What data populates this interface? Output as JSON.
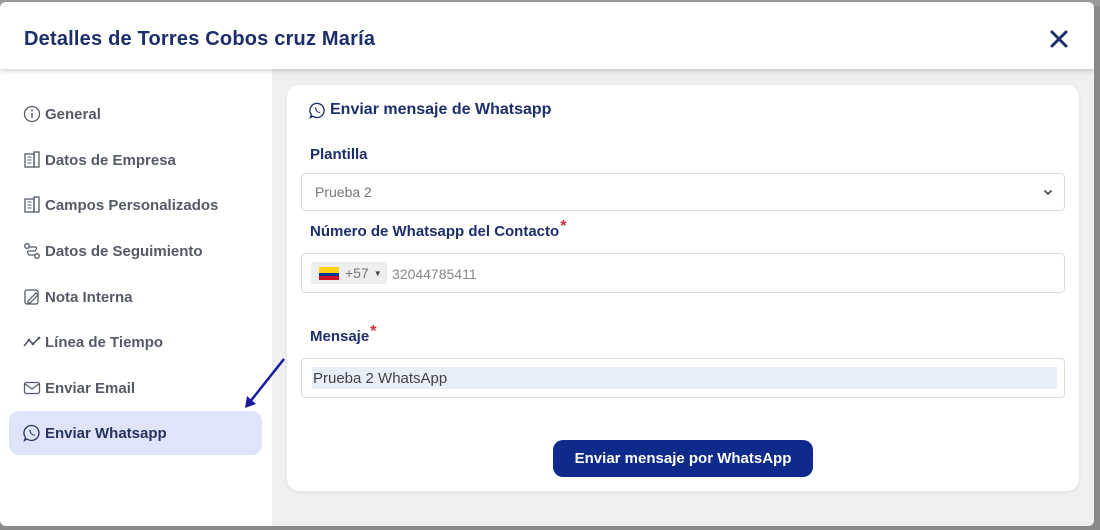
{
  "modal": {
    "title": "Detalles de Torres Cobos cruz María"
  },
  "sidebar": {
    "items": [
      {
        "label": "General",
        "icon": "info-icon"
      },
      {
        "label": "Datos de Empresa",
        "icon": "building-icon"
      },
      {
        "label": "Campos Personalizados",
        "icon": "building-icon"
      },
      {
        "label": "Datos de Seguimiento",
        "icon": "route-icon"
      },
      {
        "label": "Nota Interna",
        "icon": "edit-note-icon"
      },
      {
        "label": "Línea de Tiempo",
        "icon": "timeline-icon"
      },
      {
        "label": "Enviar Email",
        "icon": "envelope-icon"
      },
      {
        "label": "Enviar Whatsapp",
        "icon": "whatsapp-icon",
        "active": true
      }
    ]
  },
  "form": {
    "title": "Enviar mensaje de Whatsapp",
    "template_label": "Plantilla",
    "template_value": "Prueba 2",
    "phone_label": "Número de Whatsapp del Contacto",
    "required_mark": "*",
    "dial_code": "+57",
    "phone_value": "32044785411",
    "message_label": "Mensaje",
    "message_value": "Prueba 2 WhatsApp",
    "submit_label": "Enviar mensaje por WhatsApp"
  },
  "colors": {
    "primary": "#0e2a8a",
    "title": "#1c2e6b",
    "active_bg": "#dfe4fb",
    "required": "#d62b3a",
    "arrow": "#1a1a9c"
  }
}
